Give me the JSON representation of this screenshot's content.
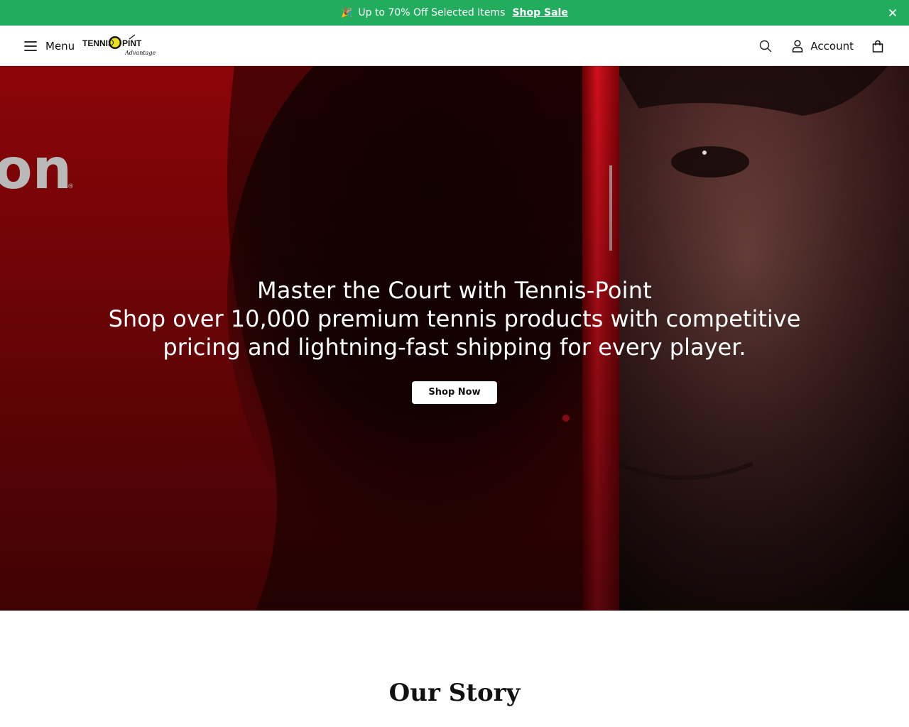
{
  "announcement": {
    "emoji": "🎉",
    "text": "Up to 70% Off Selected Items",
    "link_label": "Shop Sale",
    "close_icon": "close-icon"
  },
  "header": {
    "menu_label": "Menu",
    "logo_alt": "Tennis Point Advantage You",
    "account_label": "Account"
  },
  "hero": {
    "title": "Master the Court with Tennis-Point",
    "subtitle": "Shop over 10,000 premium tennis products with competitive pricing and lightning-fast shipping for every player.",
    "button_label": "Shop Now",
    "logo_fragment": "on"
  },
  "story": {
    "title": "Our Story"
  },
  "colors": {
    "announcement_bg": "#22ad5e",
    "hero_red": "#8a0508",
    "button_bg": "#ffffff"
  }
}
